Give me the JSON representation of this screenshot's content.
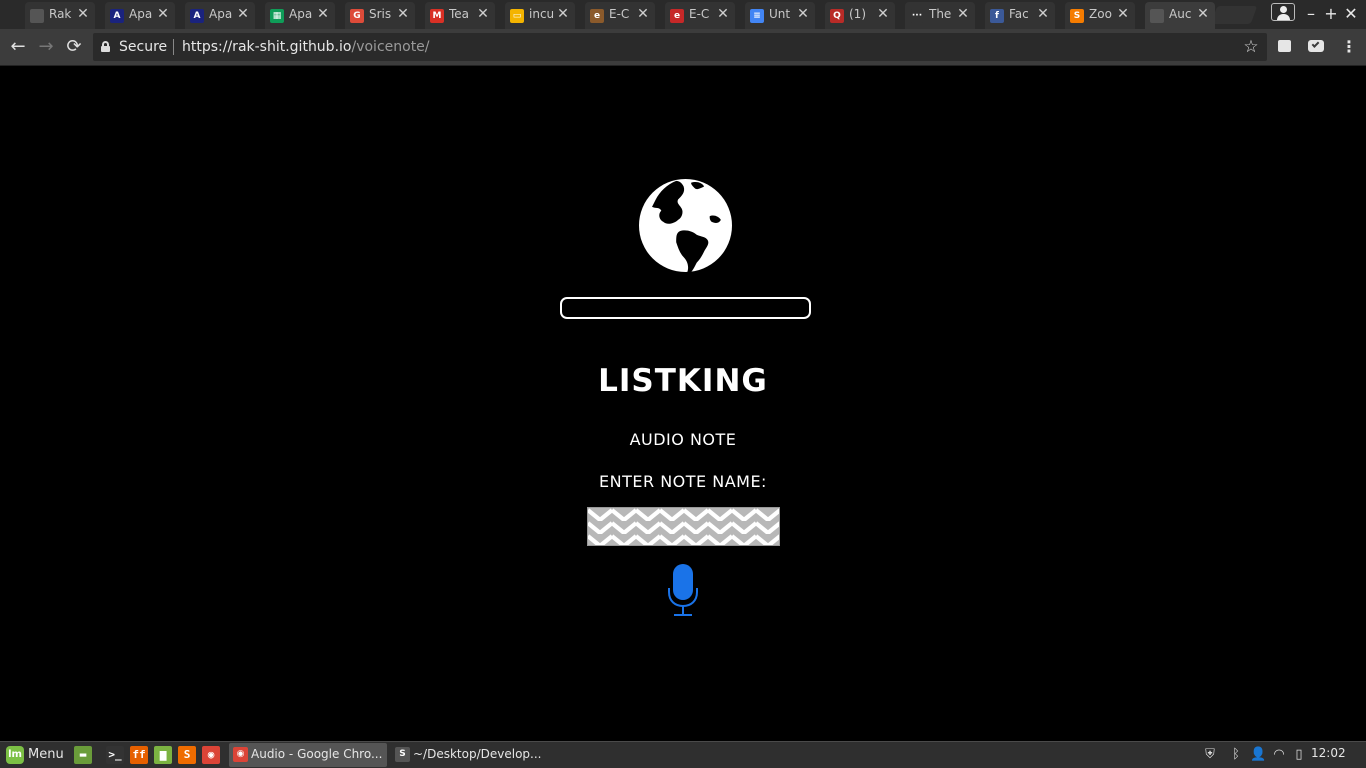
{
  "browser": {
    "tabs": [
      {
        "title": "Rak",
        "favicon": "doc-icon",
        "color": "#555555",
        "glyph": ""
      },
      {
        "title": "Apa",
        "favicon": "apache-icon",
        "color": "#1a237e",
        "glyph": "A"
      },
      {
        "title": "Apa",
        "favicon": "apache-icon",
        "color": "#1a237e",
        "glyph": "A"
      },
      {
        "title": "Apa",
        "favicon": "sheets-icon",
        "color": "#0f9d58",
        "glyph": "▦"
      },
      {
        "title": "Sris",
        "favicon": "gplus-icon",
        "color": "#dd4b39",
        "glyph": "G"
      },
      {
        "title": "Tea",
        "favicon": "gmail-icon",
        "color": "#d93025",
        "glyph": "M"
      },
      {
        "title": "incu",
        "favicon": "slides-icon",
        "color": "#f4b400",
        "glyph": "▭"
      },
      {
        "title": "E-C",
        "favicon": "ecommerce-icon",
        "color": "#8b5a2b",
        "glyph": "e"
      },
      {
        "title": "E-C",
        "favicon": "ecommerce-icon",
        "color": "#c62828",
        "glyph": "e"
      },
      {
        "title": "Unt",
        "favicon": "docs-icon",
        "color": "#4285f4",
        "glyph": "≡"
      },
      {
        "title": "(1)",
        "favicon": "quora-icon",
        "color": "#b92b27",
        "glyph": "Q"
      },
      {
        "title": "The",
        "favicon": "dots-icon",
        "color": "#333333",
        "glyph": "···"
      },
      {
        "title": "Fac",
        "favicon": "facebook-icon",
        "color": "#3b5998",
        "glyph": "f"
      },
      {
        "title": "Zoo",
        "favicon": "sublime-icon",
        "color": "#f57c00",
        "glyph": "S"
      },
      {
        "title": "Auc",
        "favicon": "doc-icon",
        "color": "#555555",
        "glyph": ""
      }
    ],
    "active_tab_index": 14,
    "close_glyph": "✕",
    "window_controls": {
      "minimize": "–",
      "new_window": "+",
      "close": "✕"
    },
    "toolbar": {
      "back_glyph": "←",
      "forward_glyph": "→",
      "reload_glyph": "⟳",
      "secure_label": "Secure",
      "url_host": "https://rak-shit.github.io",
      "url_path": "/voicenote/",
      "star_glyph": "☆",
      "menu_glyph": "⋮"
    }
  },
  "page": {
    "name_display_value": "",
    "title": "LISTKING",
    "subtitle": "AUDIO NOTE",
    "note_label": "ENTER NOTE NAME:",
    "note_input_value": "",
    "colors": {
      "background": "#000000",
      "text": "#ffffff",
      "mic": "#1a73e8"
    }
  },
  "taskbar": {
    "menu_label": "Menu",
    "launchers": [
      {
        "name": "show-desktop-icon",
        "color": "#6a9c3a",
        "glyph": "▬"
      },
      {
        "name": "terminal-icon",
        "color": "#333333",
        "glyph": ">_"
      },
      {
        "name": "firefox-icon",
        "color": "#e66000",
        "glyph": "ff"
      },
      {
        "name": "files-icon",
        "color": "#7cb342",
        "glyph": "▆"
      },
      {
        "name": "sublime-icon",
        "color": "#ef6c00",
        "glyph": "S"
      },
      {
        "name": "chrome-icon",
        "color": "#db4437",
        "glyph": "◉"
      }
    ],
    "tasks": [
      {
        "label": "Audio - Google Chro...",
        "icon": "chrome-icon",
        "color": "#db4437",
        "glyph": "◉",
        "active": true
      },
      {
        "label": "~/Desktop/Develop...",
        "icon": "sublime-icon",
        "color": "#555555",
        "glyph": "S",
        "active": false
      }
    ],
    "tray": [
      "shield-icon",
      "bluetooth-icon",
      "user-icon",
      "wifi-icon",
      "battery-icon"
    ],
    "tray_glyphs": [
      "⛨",
      "ᛒ",
      "👤",
      "◠",
      "▯"
    ],
    "clock": "12:02"
  }
}
